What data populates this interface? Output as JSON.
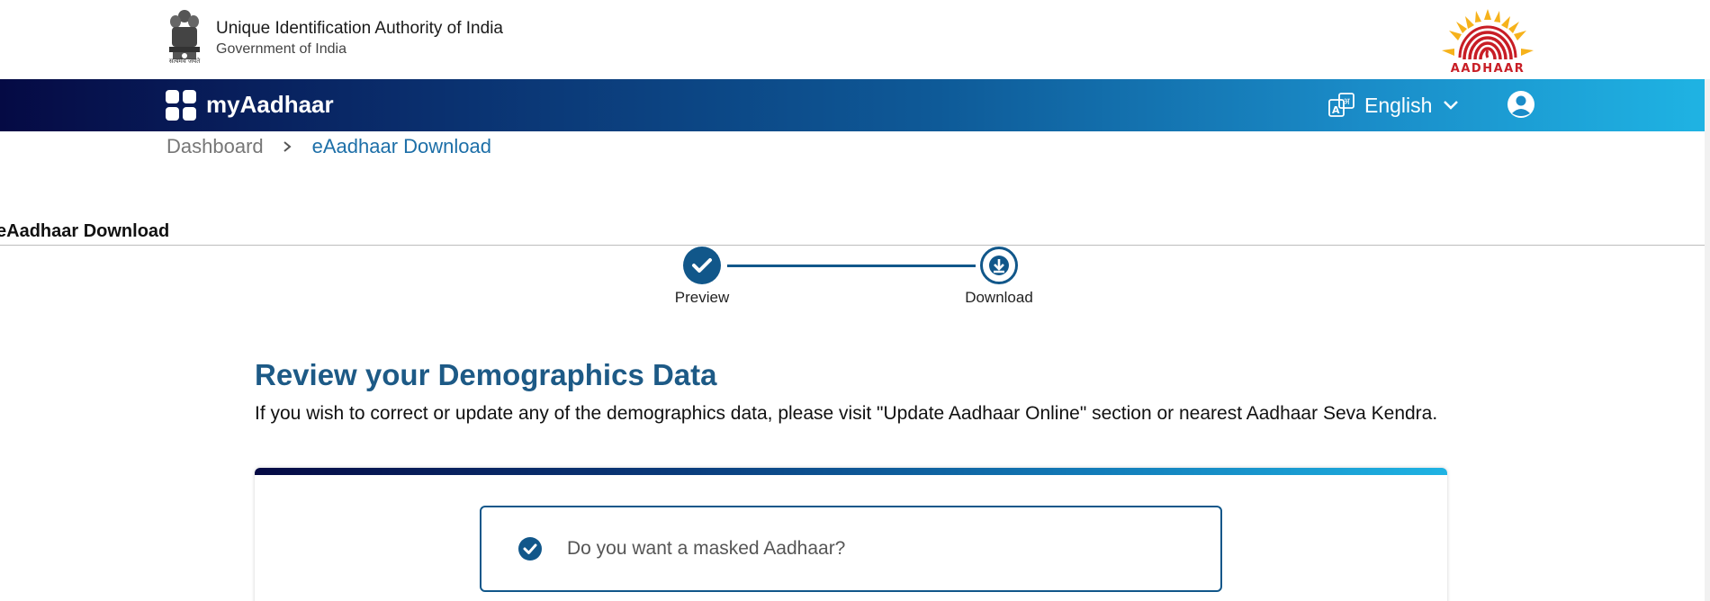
{
  "header": {
    "org_title": "Unique Identification Authority of India",
    "org_subtitle": "Government of India",
    "emblem_caption": "सत्यमेव जयते",
    "logo_word": "AADHAAR"
  },
  "navbar": {
    "brand": "myAadhaar",
    "language": "English",
    "icons": [
      "apps-grid-icon",
      "translate-icon",
      "chevron-down-icon",
      "user-account-icon"
    ]
  },
  "breadcrumb": {
    "items": [
      "Dashboard",
      "eAadhaar Download"
    ]
  },
  "section": {
    "title": "eAadhaar Download"
  },
  "stepper": {
    "steps": [
      {
        "label": "Preview",
        "state": "completed"
      },
      {
        "label": "Download",
        "state": "current"
      }
    ]
  },
  "review": {
    "title": "Review your Demographics Data",
    "description": "If you wish to correct or update any of the demographics data, please visit \"Update Aadhaar Online\" section or nearest Aadhaar Seva Kendra."
  },
  "masked_option": {
    "label": "Do you want a masked Aadhaar?",
    "checked": true
  },
  "colors": {
    "primary": "#11578a",
    "link": "#1d6fa8",
    "heading": "#1d5a86",
    "nav_start": "#050a44",
    "nav_end": "#1fb3e3",
    "logo_red": "#c81d25",
    "logo_yellow": "#f6b21b"
  }
}
